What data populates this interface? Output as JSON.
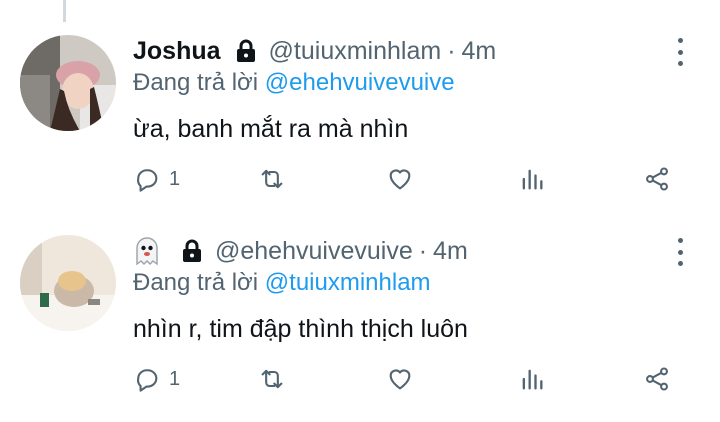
{
  "thread": {
    "tweets": [
      {
        "display_name": "Joshua",
        "handle": "@tuiuxminhlam",
        "separator": "·",
        "time": "4m",
        "replying_prefix": "Đang trả lời",
        "replying_to": "@ehehvuivevuive",
        "text": "ừa, banh mắt ra mà nhìn",
        "reply_count": "1",
        "name_badge_icon": "lock-icon",
        "avatar_desc": "avatar-photo"
      },
      {
        "display_name": "",
        "handle": "@ehehvuivevuive",
        "separator": "·",
        "time": "4m",
        "replying_prefix": "Đang trả lời",
        "replying_to": "@tuiuxminhlam",
        "text": "nhìn r, tim đập thình thịch luôn",
        "reply_count": "1",
        "name_badge_icon": "ghost-emoji-icon",
        "avatar_desc": "avatar-photo"
      }
    ]
  },
  "colors": {
    "secondary_text": "#536471",
    "mention": "#1d9bf0",
    "primary_text": "#0f1419",
    "thread_line": "#cfd9de"
  },
  "icons": [
    "reply-icon",
    "retweet-icon",
    "like-icon",
    "analytics-icon",
    "share-icon",
    "more-icon",
    "lock-icon",
    "ghost-emoji-icon"
  ]
}
